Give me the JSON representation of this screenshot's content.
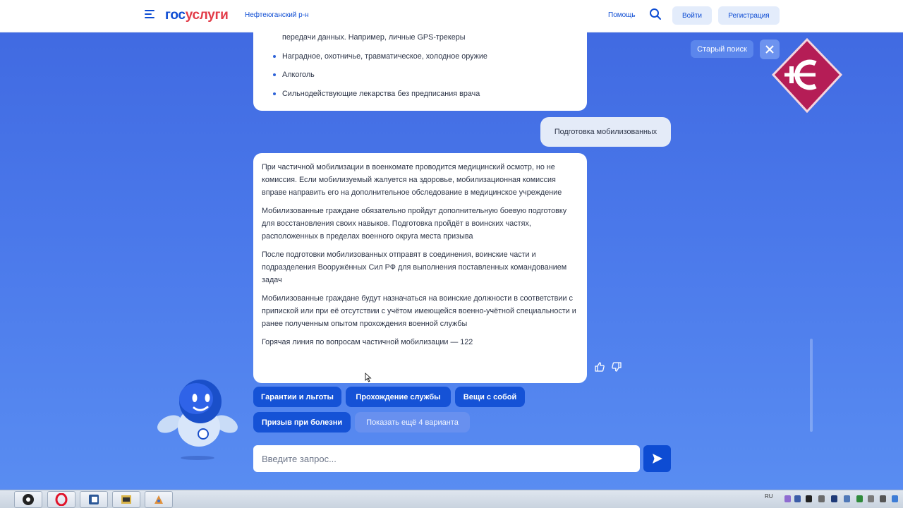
{
  "header": {
    "logo_part1": "гос",
    "logo_part2": "услуги",
    "region": "Нефтеюганский р-н",
    "help": "Помощь",
    "login": "Войти",
    "register": "Регистрация"
  },
  "controls": {
    "old_search": "Старый поиск"
  },
  "chat": {
    "bot_message_1": {
      "items": [
        "передачи данных. Например, личные GPS-трекеры",
        "Наградное, охотничье, травматическое, холодное оружие",
        "Алкоголь",
        "Сильнодействующие лекарства без предписания врача"
      ]
    },
    "user_message": "Подготовка мобилизованных",
    "bot_message_2": {
      "paragraphs": [
        "При частичной мобилизации в военкомате проводится медицинский осмотр, но не комиссия. Если мобилизуемый жалуется на здоровье, мобилизационная комиссия вправе направить его на дополнительное обследование в медицинское учреждение",
        "Мобилизованные граждане обязательно пройдут дополнительную боевую подготовку для восстановления своих навыков. Подготовка пройдёт в воинских частях, расположенных в пределах военного округа места призыва",
        "После подготовки мобилизованных отправят в соединения, воинские части и подразделения Вооружённых Сил РФ для выполнения поставленных командованием задач",
        "Мобилизованные граждане будут назначаться на воинские должности в соответствии с припиской или при её отсутствии с учётом имеющейся военно-учётной специальности и ранее полученным опытом прохождения военной службы",
        "Горячая линия по вопросам частичной мобилизации — 122"
      ]
    },
    "suggestions": [
      "Гарантии и льготы",
      "Прохождение службы",
      "Вещи с собой",
      "Призыв при болезни",
      "Показать ещё 4 варианта"
    ],
    "input_placeholder": "Введите запрос..."
  },
  "taskbar": {
    "language": "RU"
  },
  "colors": {
    "brand_blue": "#0d4cd3",
    "brand_red": "#e23b48",
    "background_blue": "#4a78ea"
  }
}
